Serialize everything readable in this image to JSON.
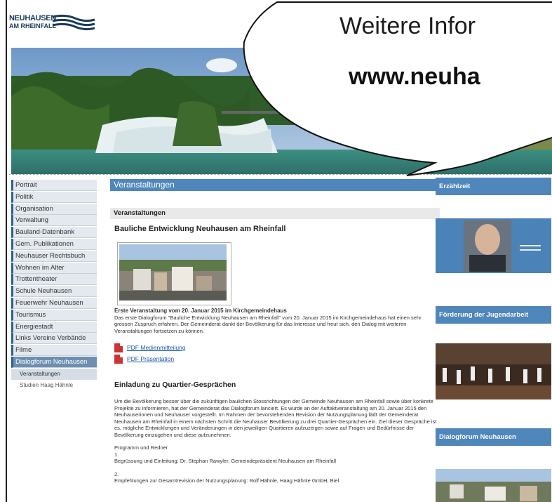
{
  "logo": {
    "line1": "NEUHAUSEN",
    "line2": "AM RHEINFALL"
  },
  "bubble": {
    "line1": "Weitere Infor",
    "line2": "www.neuha"
  },
  "nav": {
    "items": [
      {
        "label": "Portrait"
      },
      {
        "label": "Politik"
      },
      {
        "label": "Organisation"
      },
      {
        "label": "Verwaltung"
      },
      {
        "label": "Bauland-Datenbank"
      },
      {
        "label": "Gem. Publikationen"
      },
      {
        "label": "Neuhauser Rechtsbuch"
      },
      {
        "label": "Wohnen im Alter"
      },
      {
        "label": "Trottentheater"
      },
      {
        "label": "Schule Neuhausen"
      },
      {
        "label": "Feuerwehr Neuhausen"
      },
      {
        "label": "Tourismus"
      },
      {
        "label": "Energiestadt"
      },
      {
        "label": "Links Vereine Verbände"
      },
      {
        "label": "Filme"
      },
      {
        "label": "Dialogforum Neuhausen"
      }
    ],
    "sub": [
      {
        "label": "Veranstaltungen"
      },
      {
        "label": "Studien Haag Hähnle"
      }
    ]
  },
  "main": {
    "header": "Veranstaltungen",
    "section": "Veranstaltungen",
    "title": "Bauliche Entwicklung Neuhausen am Rheinfall",
    "event1_heading": "Erste Veranstaltung vom 20. Januar 2015 im Kirchgemeindehaus",
    "event1_text": "Das erste Dialogforum \"Bauliche Entwicklung Neuhausen am Rheinfall\" vom 20. Januar 2015 im Kirchgemeindehaus hat einen sehr grossen Zuspruch erfahren. Der Gemeinderat dankt der Bevölkerung für das Interesse und freut sich, den Dialog mit weiteren Veranstaltungen fortsetzen zu können.",
    "pdf1": "PDF Medienmitteilung",
    "pdf2": "PDF Präsentation",
    "invite_title": "Einladung zu Quartier-Gesprächen",
    "invite_text": "Um die Bevölkerung besser über die zukünftigen baulichen Stossrichtungen der Gemeinde Neuhausen am Rheinfall sowie über konkrete Projekte zu informieren, hat der Gemeinderat das Dialogforum lanciert. Es wurde an der Auftaktveranstaltung am 20. Januar 2015 den Neuhauserinnen und Neuhauser vorgestellt. Im Rahmen der bevorstehenden Revision der Nutzungsplanung lädt der Gemeinderat Neuhausen am Rheinfall in einem nächsten Schritt die Neuhauser Bevölkerung zu drei Quartier-Gesprächen ein. Ziel dieser Gespräche ist es, mögliche Entwicklungen und Veränderungen in den jeweiligen Quartieren aufzuzeigen sowie auf Fragen und Bedürfnisse der Bevölkerung einzugehen und diese aufzunehmen.",
    "program_label": "Programm und Redner",
    "p1_num": "1.",
    "p1_text": "Begrüssung und Einleitung: Dr. Stephan Rawyler, Gemeindepräsident Neuhausen am Rheinfall",
    "p2_num": "2.",
    "p2_text": "Empfehlungen zur Gesamtrevision der Nutzungsplanung: Rolf Hähnle, Haag Hähnle GmbH, Biel"
  },
  "right": {
    "box1": "Erzählzeit",
    "box2": "Förderung der Jugendarbeit",
    "box3": "Dialogforum Neuhausen"
  },
  "colors": {
    "accent": "#4f86bb",
    "nav_bg": "#e4e9ef",
    "nav_active": "#6d8fb0"
  }
}
